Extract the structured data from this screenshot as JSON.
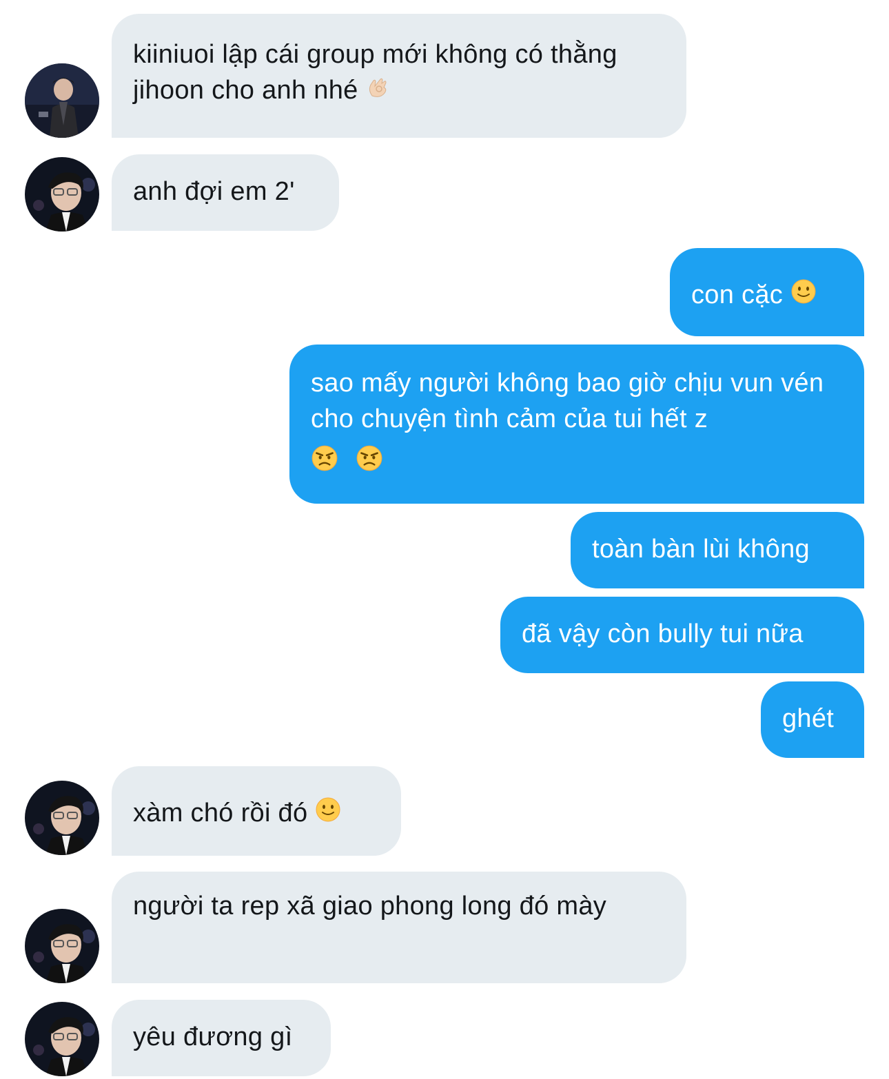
{
  "messages": [
    {
      "id": "m1",
      "direction": "received",
      "sender": "contact-a",
      "text": "kiiniuoi lập cái group mới không có thằng jihoon cho anh nhé",
      "emoji": "ok-hand-emoji"
    },
    {
      "id": "m2",
      "direction": "received",
      "sender": "contact-b",
      "text": "anh đợi em 2'"
    },
    {
      "id": "m3",
      "direction": "sent",
      "text": "con cặc",
      "emoji": "slight-smile-emoji"
    },
    {
      "id": "m4",
      "direction": "sent",
      "text": "sao mấy người không bao giờ chịu vun vén cho chuyện tình cảm của tui hết z",
      "emoji": "angry-face-emoji x2"
    },
    {
      "id": "m5",
      "direction": "sent",
      "text": "toàn bàn lùi không"
    },
    {
      "id": "m6",
      "direction": "sent",
      "text": "đã vậy còn bully tui nữa"
    },
    {
      "id": "m7",
      "direction": "sent",
      "text": "ghét"
    },
    {
      "id": "m8",
      "direction": "received",
      "sender": "contact-b",
      "text": "xàm chó rồi đó",
      "emoji": "slight-smile-emoji"
    },
    {
      "id": "m9",
      "direction": "received",
      "sender": "contact-b",
      "text": "người ta rep xã giao phong long đó mày"
    },
    {
      "id": "m10",
      "direction": "received",
      "sender": "contact-b",
      "text": "yêu đương gì"
    }
  ],
  "colors": {
    "received_bubble": "#e6ecf0",
    "sent_bubble": "#1da1f2",
    "received_text": "#14171a",
    "sent_text": "#ffffff"
  }
}
